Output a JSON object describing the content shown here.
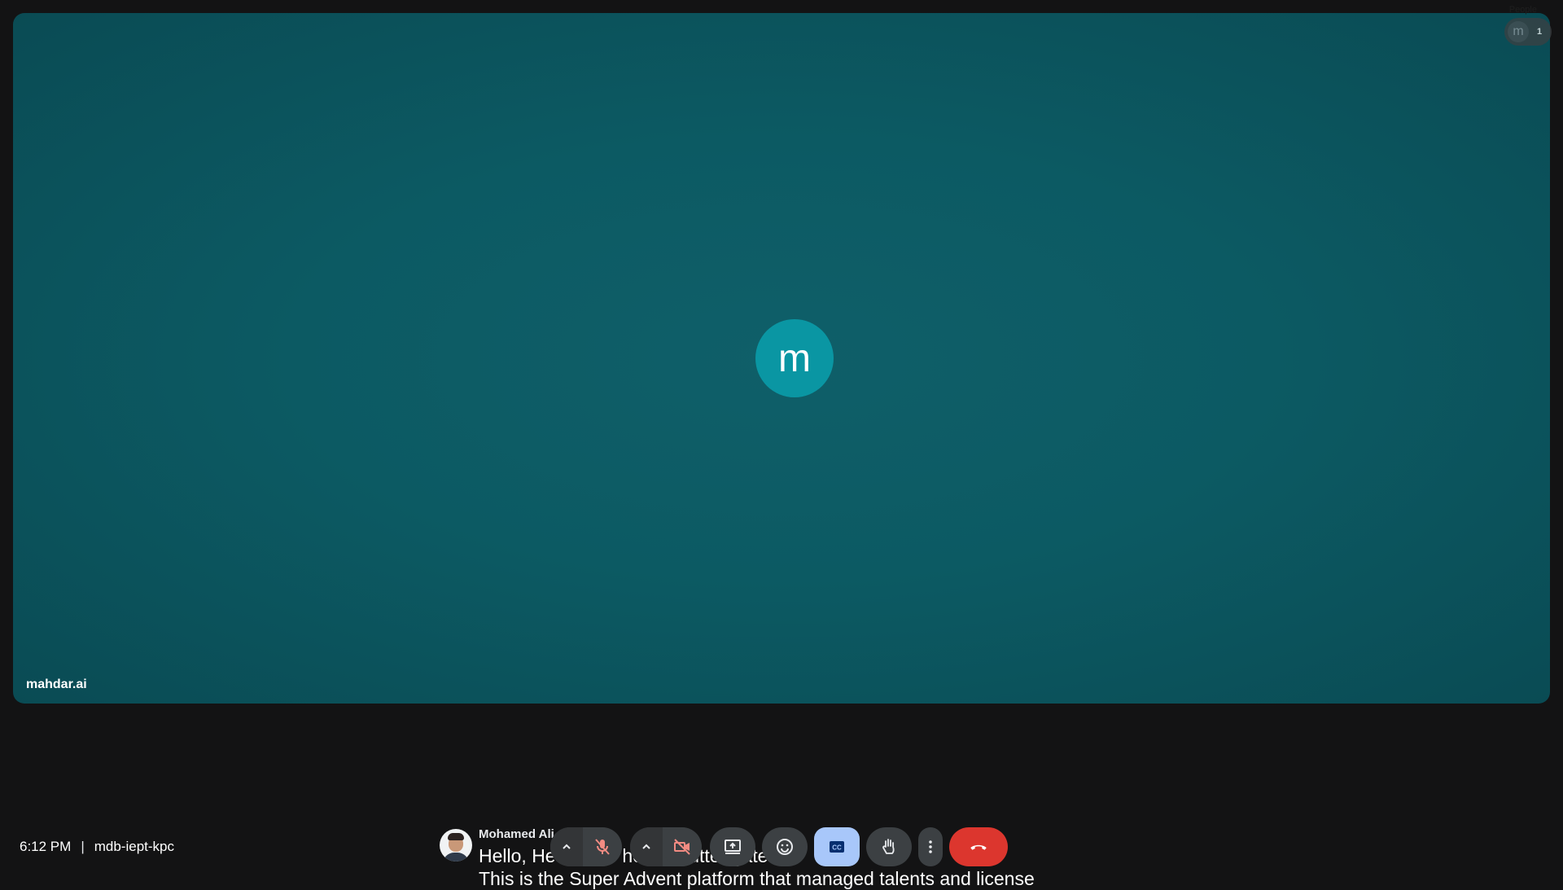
{
  "tile": {
    "avatar_initial": "m",
    "participant_name": "mahdar.ai"
  },
  "people": {
    "label": "People",
    "avatar_initial": "m",
    "count": "1"
  },
  "meeting": {
    "time": "6:12 PM",
    "separator": "|",
    "code": "mdb-iept-kpc"
  },
  "captions": {
    "speaker": "Mohamed Ali",
    "line1": "Hello, He     t     da    ve    ho      ti        n      t   utter gate?",
    "line2": "This is the Super Advent platform that managed talents and license"
  },
  "controls": {
    "mic_options_icon": "chevron-up-icon",
    "mic_icon": "mic-off-icon",
    "camera_options_icon": "chevron-up-icon",
    "camera_icon": "camera-off-icon",
    "present_icon": "present-screen-icon",
    "reactions_icon": "emoji-icon",
    "captions_icon": "closed-captions-icon",
    "raise_hand_icon": "hand-icon",
    "more_icon": "more-vert-icon",
    "leave_icon": "call-end-icon"
  },
  "colors": {
    "stage": "#0c5a63",
    "avatar": "#0a96a3",
    "captions_active": "#a8c7fa",
    "end_call": "#dc362e",
    "muted_red": "#f28b82"
  }
}
